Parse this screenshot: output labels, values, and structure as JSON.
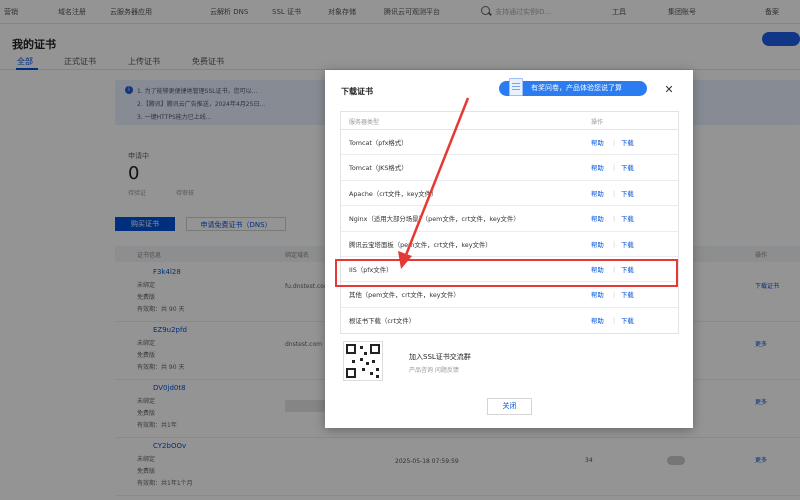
{
  "topnav": {
    "items": [
      {
        "label": "营销"
      },
      {
        "label": "域名注册"
      },
      {
        "label": "云服务器应用"
      },
      {
        "label": "云解析 DNS"
      },
      {
        "label": "SSL 证书"
      },
      {
        "label": "对象存储"
      },
      {
        "label": "腾讯云可观测平台"
      },
      {
        "label": "工具"
      },
      {
        "label": "集团账号"
      },
      {
        "label": "备案"
      }
    ],
    "search_placeholder": "支持通过实例ID..."
  },
  "page": {
    "title": "我的证书",
    "tabs": [
      {
        "label": "全部"
      },
      {
        "label": "正式证书"
      },
      {
        "label": "上传证书"
      },
      {
        "label": "免费证书"
      }
    ],
    "notice_lines": [
      "1. 为了能够更便捷地管理SSL证书，您可以...",
      "2.【腾讯】腾讯云广告推送，2024年4月25日...",
      "3. 一键HTTPS能力已上线..."
    ],
    "stat": {
      "label": "申请中",
      "value": "0",
      "sub_a": "待验证",
      "sub_b": "待审核"
    },
    "buttons": {
      "apply": "购买证书",
      "upload": "申请免费证书（DNS）"
    },
    "table_headers": [
      "证书信息",
      "绑定域名",
      "操作"
    ],
    "rows": [
      {
        "id": "F3k4l28",
        "l1": "未绑定",
        "l2": "免费版",
        "l3": "有效期：共 90 天",
        "domain": "fu.dnstest.com",
        "op": "下载证书"
      },
      {
        "id": "EZ9u2pfd",
        "l1": "未绑定",
        "l2": "免费版",
        "l3": "有效期：共 90 天",
        "domain": "dnstest.com",
        "op": "更多"
      },
      {
        "id": "DV0jd0t8",
        "l1": "未绑定",
        "l2": "免费版",
        "l3": "有效期：共1年",
        "domain": "",
        "op": "更多"
      },
      {
        "id": "CY2bOOv",
        "l1": "未绑定",
        "l2": "免费版",
        "l3": "有效期：共1年1个月",
        "domain": "",
        "op": "更多",
        "date": "2025-05-18 07:59:59",
        "count": "34"
      }
    ]
  },
  "modal": {
    "title": "下载证书",
    "survey_banner": "有奖问卷，产品体验您说了算",
    "table": {
      "header_server": "服务器类型",
      "header_action": "操作",
      "help_label": "帮助",
      "download_label": "下载",
      "separator": "|",
      "rows": [
        {
          "server": "Tomcat（pfx格式）"
        },
        {
          "server": "Tomcat（JKS格式）"
        },
        {
          "server": "Apache（crt文件，key文件）"
        },
        {
          "server": "Nginx（适用大部分场景）（pem文件，crt文件，key文件）"
        },
        {
          "server": "腾讯云宝塔面板（pem文件，crt文件，key文件）"
        },
        {
          "server": "IIS（pfx文件）"
        },
        {
          "server": "其他（pem文件，crt文件，key文件）"
        },
        {
          "server": "根证书下载（crt文件）"
        }
      ]
    },
    "group_title": "加入SSL证书交流群",
    "group_sub": "产品咨询 问题反馈",
    "close_label": "关闭"
  },
  "colors": {
    "accent": "#0052d9",
    "highlight": "#e53935",
    "banner": "#2a7cf0"
  }
}
